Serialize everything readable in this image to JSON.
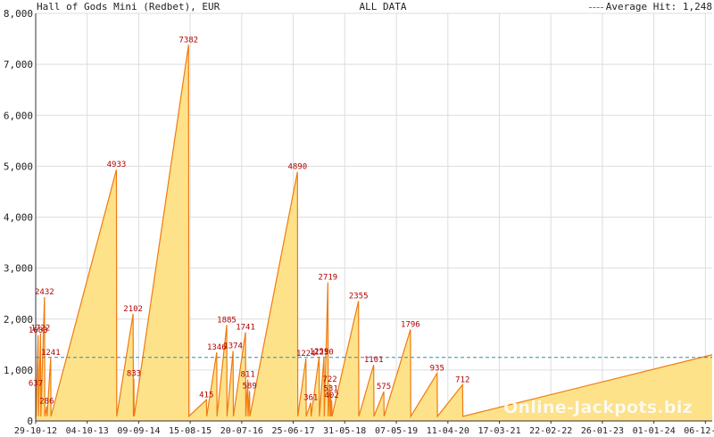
{
  "header": {
    "title": "Hall of Gods Mini (Redbet), EUR",
    "subtitle": "ALL DATA",
    "legend_label": "Average Hit: 1,248"
  },
  "watermark": "Online-Jackpots.biz",
  "colors": {
    "fill": "#fde28a",
    "line": "#f07b10",
    "label": "#b00000",
    "average": "#2a8fb0",
    "grid": "#dddddd"
  },
  "chart_data": {
    "type": "area",
    "xlabel": "",
    "ylabel": "",
    "ylim": [
      0,
      8000
    ],
    "yticks": [
      0,
      1000,
      2000,
      3000,
      4000,
      5000,
      6000,
      7000,
      8000
    ],
    "ytick_labels": [
      "0",
      "1,000",
      "2,000",
      "3,000",
      "4,000",
      "5,000",
      "6,000",
      "7,000",
      "8,000"
    ],
    "xlim": [
      "2012-10-29",
      "2025-01-20"
    ],
    "xticks": [
      "2012-10-29",
      "2013-10-04",
      "2014-09-09",
      "2015-08-15",
      "2016-07-20",
      "2017-06-25",
      "2018-05-31",
      "2019-05-07",
      "2020-04-11",
      "2021-03-17",
      "2022-02-20",
      "2023-01-26",
      "2024-01-01",
      "2024-12-06"
    ],
    "xtick_labels": [
      "29-10-12",
      "04-10-13",
      "09-09-14",
      "15-08-15",
      "20-07-16",
      "25-06-17",
      "31-05-18",
      "07-05-19",
      "11-04-20",
      "17-03-21",
      "22-02-22",
      "26-01-23",
      "01-01-24",
      "06-12-24"
    ],
    "grid": true,
    "average": 1248,
    "series": [
      {
        "values": [
          {
            "x": "2012-10-29",
            "y": 637,
            "label": "637"
          },
          {
            "x": "2012-11-14",
            "y": 1683,
            "label": "1683"
          },
          {
            "x": "2012-11-30",
            "y": 1722,
            "label": "1722"
          },
          {
            "x": "2012-12-26",
            "y": 2432,
            "label": "2432"
          },
          {
            "x": "2013-01-10",
            "y": 286,
            "label": "286"
          },
          {
            "x": "2013-02-05",
            "y": 1241,
            "label": "1241"
          },
          {
            "x": "2014-04-15",
            "y": 4933,
            "label": "4933"
          },
          {
            "x": "2014-08-03",
            "y": 2102,
            "label": "2102"
          },
          {
            "x": "2014-08-08",
            "y": 833,
            "label": "833"
          },
          {
            "x": "2015-08-04",
            "y": 7382,
            "label": "7382"
          },
          {
            "x": "2015-11-30",
            "y": 415,
            "label": "415"
          },
          {
            "x": "2016-02-06",
            "y": 1346,
            "label": "1346"
          },
          {
            "x": "2016-04-12",
            "y": 1885,
            "label": "1885"
          },
          {
            "x": "2016-05-24",
            "y": 1374,
            "label": "1374"
          },
          {
            "x": "2016-08-14",
            "y": 1741,
            "label": "1741"
          },
          {
            "x": "2016-08-29",
            "y": 811,
            "label": "811"
          },
          {
            "x": "2016-09-10",
            "y": 589,
            "label": "589"
          },
          {
            "x": "2017-07-23",
            "y": 4890,
            "label": "4890"
          },
          {
            "x": "2017-09-17",
            "y": 1224,
            "label": "1224"
          },
          {
            "x": "2017-10-19",
            "y": 361,
            "label": "361"
          },
          {
            "x": "2017-12-13",
            "y": 1259,
            "label": "1259"
          },
          {
            "x": "2018-01-14",
            "y": 1250,
            "label": "1250"
          },
          {
            "x": "2018-02-09",
            "y": 2719,
            "label": "2719"
          },
          {
            "x": "2018-02-22",
            "y": 722,
            "label": "722"
          },
          {
            "x": "2018-02-28",
            "y": 531,
            "label": "531"
          },
          {
            "x": "2018-03-06",
            "y": 402,
            "label": "402"
          },
          {
            "x": "2018-08-30",
            "y": 2355,
            "label": "2355"
          },
          {
            "x": "2018-12-08",
            "y": 1101,
            "label": "1101"
          },
          {
            "x": "2019-02-13",
            "y": 575,
            "label": "575"
          },
          {
            "x": "2019-08-08",
            "y": 1796,
            "label": "1796"
          },
          {
            "x": "2020-01-31",
            "y": 935,
            "label": "935"
          },
          {
            "x": "2020-07-17",
            "y": 712,
            "label": "712"
          },
          {
            "x": "2025-01-20",
            "y": 1300,
            "label": ""
          }
        ]
      }
    ]
  }
}
